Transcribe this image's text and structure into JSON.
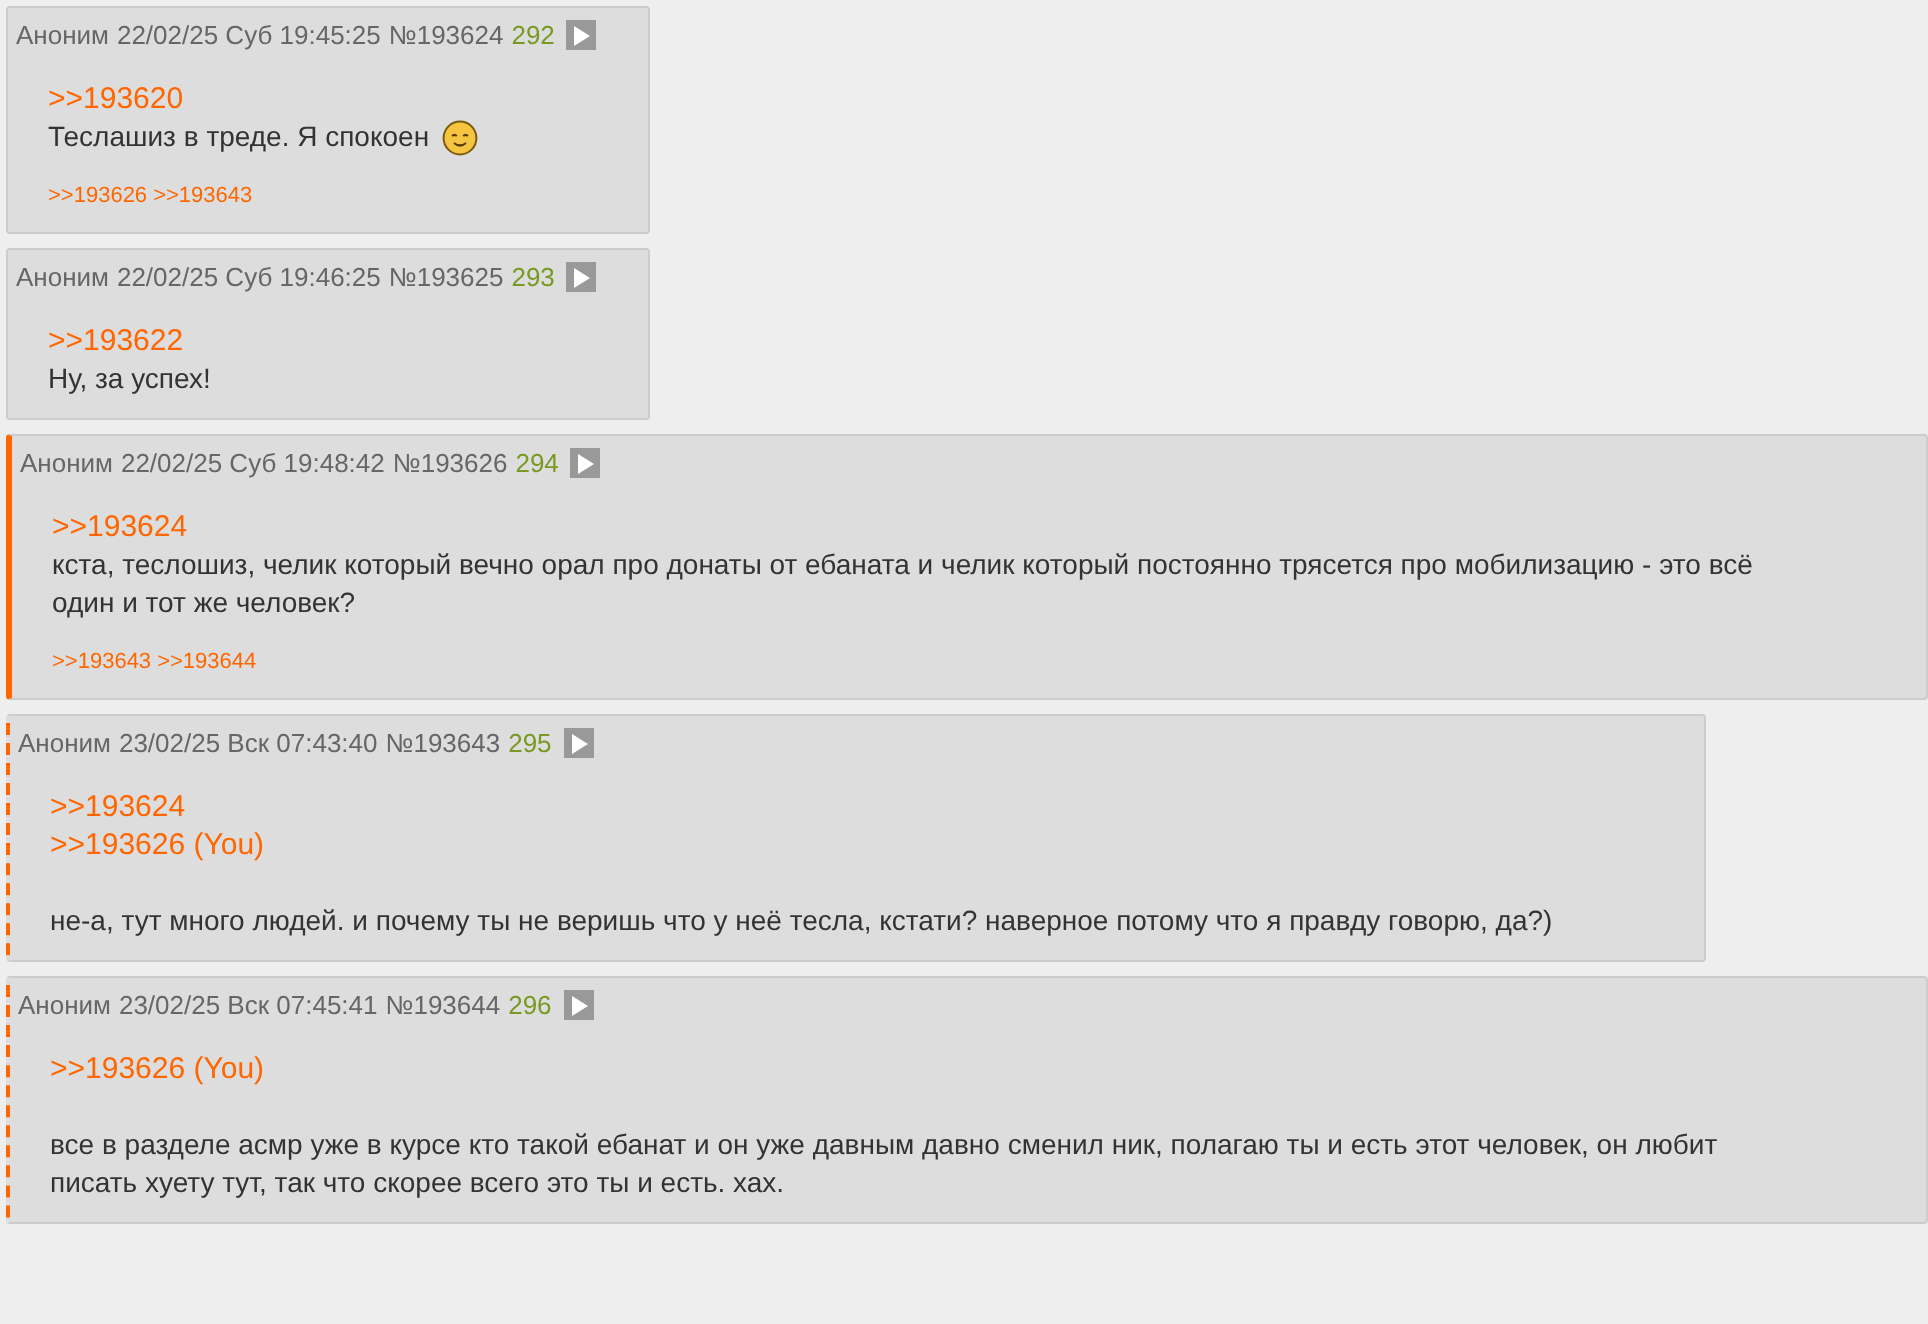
{
  "posts": [
    {
      "name": "Аноним",
      "date": "22/02/25 Суб 19:45:25",
      "number": "№193624",
      "index": "292",
      "kind": "plain",
      "body": [
        {
          "kind": "link",
          "text": ">>193620"
        },
        {
          "kind": "text",
          "text": "Теслашиз в треде. Я спокоен",
          "smiley": true
        }
      ],
      "replies": [
        ">>193626",
        ">>193643"
      ]
    },
    {
      "name": "Аноним",
      "date": "22/02/25 Суб 19:46:25",
      "number": "№193625",
      "index": "293",
      "kind": "plain",
      "body": [
        {
          "kind": "link",
          "text": ">>193622"
        },
        {
          "kind": "text",
          "text": "Ну, за успех!"
        }
      ]
    },
    {
      "name": "Аноним",
      "date": "22/02/25 Суб 19:48:42",
      "number": "№193626",
      "index": "294",
      "kind": "own",
      "body": [
        {
          "kind": "link",
          "text": ">>193624"
        },
        {
          "kind": "text",
          "text": "кста, теслошиз, челик который вечно орал про донаты от ебаната и челик который постоянно трясется про мобилизацию - это всё один и тот же человек?"
        }
      ],
      "replies": [
        ">>193643",
        ">>193644"
      ]
    },
    {
      "name": "Аноним",
      "date": "23/02/25 Вск 07:43:40",
      "number": "№193643",
      "index": "295",
      "kind": "reply",
      "body": [
        {
          "kind": "link",
          "text": ">>193624"
        },
        {
          "kind": "link",
          "text": ">>193626 (You)"
        },
        {
          "kind": "break"
        },
        {
          "kind": "text",
          "text": "не-а, тут много людей. и почему ты не веришь что у неё тесла, кстати? наверное потому что я правду говорю, да?)"
        }
      ]
    },
    {
      "name": "Аноним",
      "date": "23/02/25 Вск 07:45:41",
      "number": "№193644",
      "index": "296",
      "kind": "reply",
      "body": [
        {
          "kind": "link",
          "text": ">>193626 (You)"
        },
        {
          "kind": "break"
        },
        {
          "kind": "text",
          "text": "все в разделе асмр уже в курсе кто такой ебанат и он уже давным давно сменил ник, полагаю ты и есть этот человек, он любит писать хуету тут, так что скорее всего это ты и есть. хах."
        }
      ]
    }
  ]
}
